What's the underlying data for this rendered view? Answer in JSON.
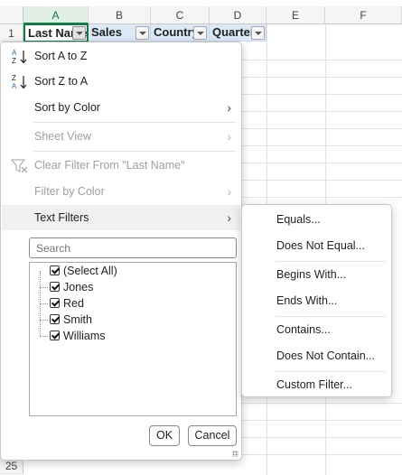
{
  "sheet": {
    "columns": [
      "A",
      "B",
      "C",
      "D",
      "E",
      "F"
    ],
    "rows": [
      "1",
      "25"
    ],
    "headers": [
      "Last Name",
      "Sales",
      "Country",
      "Quarter"
    ]
  },
  "menu": {
    "sort_asc": "Sort A to Z",
    "sort_asc_icon_top": "A",
    "sort_asc_icon_bottom": "Z",
    "sort_desc": "Sort Z to A",
    "sort_desc_icon_top": "Z",
    "sort_desc_icon_bottom": "A",
    "sort_by_color": "Sort by Color",
    "sheet_view": "Sheet View",
    "clear_filter": "Clear Filter From \"Last Name\"",
    "filter_by_color": "Filter by Color",
    "text_filters": "Text Filters",
    "search_placeholder": "Search",
    "values": [
      "(Select All)",
      "Jones",
      "Red",
      "Smith",
      "Williams"
    ],
    "ok": "OK",
    "cancel": "Cancel"
  },
  "text_filters_submenu": {
    "items": [
      "Equals...",
      "Does Not Equal...",
      "Begins With...",
      "Ends With...",
      "Contains...",
      "Does Not Contain...",
      "Custom Filter..."
    ]
  },
  "colors": {
    "accent": "#107c41",
    "header_fill": "#dce9f7",
    "sort_icon_blue": "#1f6fd1"
  }
}
